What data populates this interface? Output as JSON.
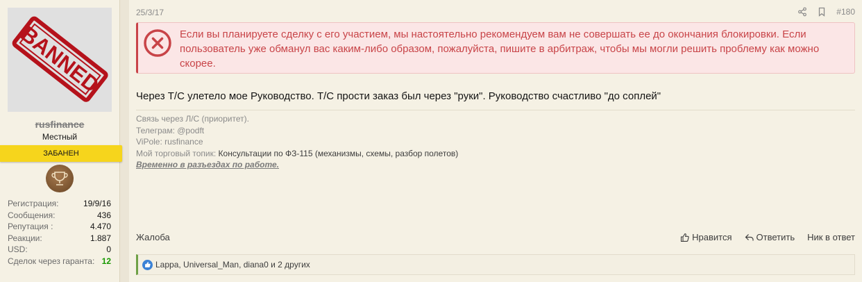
{
  "user": {
    "avatar_stamp": "BANNED",
    "username": "rusfinance",
    "title": "Местный",
    "banner": "ЗАБАНЕН",
    "stats": [
      {
        "label": "Регистрация:",
        "value": "19/9/16"
      },
      {
        "label": "Сообщения:",
        "value": "436"
      },
      {
        "label": "Репутация :",
        "value": "4.470"
      },
      {
        "label": "Реакции:",
        "value": "1.887"
      },
      {
        "label": "USD:",
        "value": "0"
      },
      {
        "label": "Сделок через гаранта:",
        "value": "12"
      }
    ]
  },
  "post": {
    "date": "25/3/17",
    "number": "#180",
    "alert": "Если вы планируете сделку с его участием, мы настоятельно рекомендуем вам не совершать ее до окончания блокировки. Если пользователь уже обманул вас каким-либо образом, пожалуйста, пишите в арбитраж, чтобы мы могли решить проблему как можно скорее.",
    "body": "Через Т/С улетело мое Руководство. Т/С прости заказ был через \"руки\". Руководство счастливо \"до соплей\"",
    "signature": {
      "line1": "Связь через Л/С (приоритет).",
      "line2": "Телеграм: @podft",
      "line3": "ViPole: rusfinance",
      "line4_prefix": "Мой торговый топик: ",
      "line4_link": "Консультации по ФЗ-115 (механизмы, схемы, разбор полетов)",
      "line5": "Временно в разъездах по работе."
    },
    "report": "Жалоба",
    "like_label": "Нравится",
    "reply_label": "Ответить",
    "nick_label": "Ник в ответ",
    "reactions_text": "Lappa, Universal_Man, diana0 и 2 других"
  },
  "colors": {
    "alert_red": "#c84448",
    "banner_yellow": "#f6d51c",
    "like_blue": "#3b82d6",
    "guarantor_green": "#179800"
  },
  "icons": [
    "share-icon",
    "bookmark-icon",
    "error-x-icon",
    "thumbs-up-icon",
    "reply-icon",
    "like-reaction-icon",
    "trophy-icon"
  ]
}
